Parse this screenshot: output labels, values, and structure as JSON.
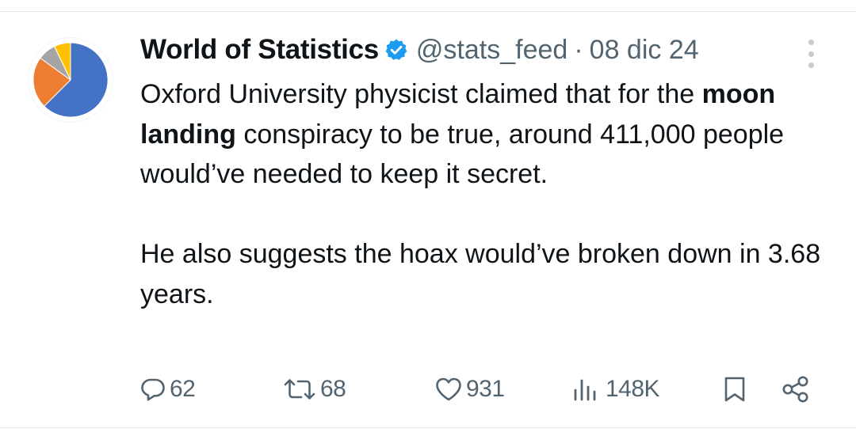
{
  "tweet": {
    "author": {
      "display_name": "World of Statistics",
      "handle": "@stats_feed",
      "verified": true
    },
    "separator": "·",
    "date": "08 dic 24",
    "text": {
      "lead": "Oxford University physicist claimed that for the ",
      "bold": "moon landing",
      "rest": " conspiracy to be true, around 411,000 people would’ve needed to keep it secret.",
      "paragraph2": "He also suggests the hoax would’ve broken down in 3.68 years."
    },
    "metrics": {
      "replies": "62",
      "reposts": "68",
      "likes": "931",
      "views": "148K"
    }
  },
  "icons": {
    "avatar": "pie-chart-avatar",
    "verified": "verified-badge-icon",
    "more": "more-vertical-icon",
    "reply": "reply-icon",
    "repost": "repost-icon",
    "like": "heart-icon",
    "views": "views-icon",
    "bookmark": "bookmark-icon",
    "share": "share-icon"
  },
  "colors": {
    "text": "#0f1419",
    "secondary": "#536471",
    "verified": "#1d9bf0",
    "avatar_blue": "#4472c4",
    "avatar_orange": "#ed7d31",
    "avatar_gray": "#a5a5a5",
    "avatar_yellow": "#ffc000"
  }
}
